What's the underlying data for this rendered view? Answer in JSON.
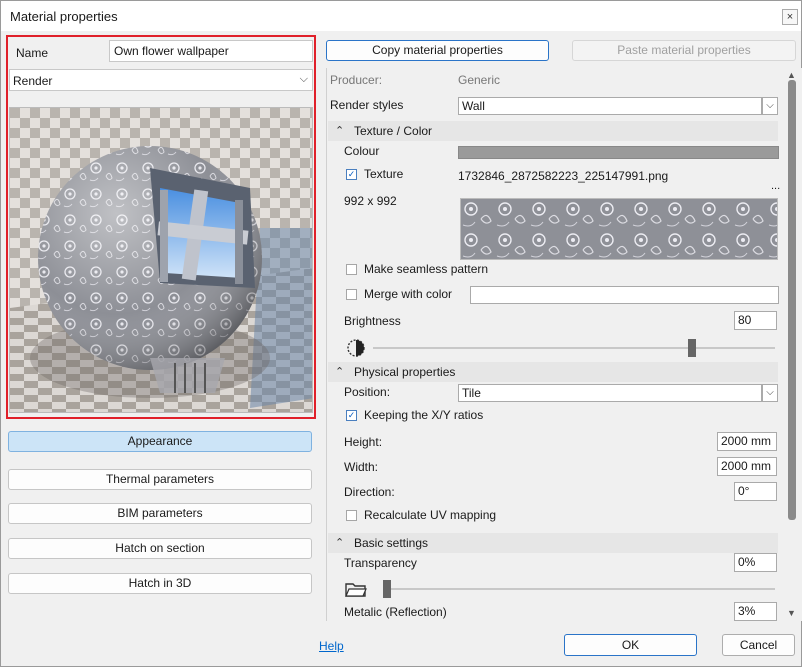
{
  "window": {
    "title": "Material properties",
    "close_glyph": "×"
  },
  "left": {
    "name_label": "Name",
    "name_value": "Own flower wallpaper",
    "render_mode": "Render",
    "buttons": {
      "appearance": "Appearance",
      "thermal": "Thermal parameters",
      "bim": "BIM parameters",
      "hatch_section": "Hatch on section",
      "hatch_3d": "Hatch in 3D"
    }
  },
  "toolbar": {
    "copy_label": "Copy material properties",
    "paste_label": "Paste material properties"
  },
  "props": {
    "producer_label": "Producer:",
    "producer_value": "Generic",
    "render_styles_label": "Render styles",
    "render_styles_value": "Wall",
    "texture_section": "Texture / Color",
    "colour_label": "Colour",
    "colour_value": "#9a9a9a",
    "texture_label": "Texture",
    "texture_checked": true,
    "texture_file": "1732846_2872582223_225147991.png",
    "texture_more": "...",
    "texture_size": "992 x 992",
    "seamless_label": "Make seamless pattern",
    "seamless_checked": false,
    "merge_label": "Merge with color",
    "merge_checked": false,
    "brightness_label": "Brightness",
    "brightness_value": "80",
    "brightness_level": 0.8,
    "physical_section": "Physical properties",
    "position_label": "Position:",
    "position_value": "Tile",
    "keep_ratio_label": "Keeping the X/Y ratios",
    "keep_ratio_checked": true,
    "height_label": "Height:",
    "height_value": "2000 mm",
    "width_label": "Width:",
    "width_value": "2000 mm",
    "direction_label": "Direction:",
    "direction_value": "0°",
    "recalc_label": "Recalculate UV mapping",
    "recalc_checked": false,
    "basic_section": "Basic settings",
    "transparency_label": "Transparency",
    "transparency_value": "0%",
    "transparency_level": 0.0,
    "metalic_label": "Metalic (Reflection)",
    "metalic_value": "3%"
  },
  "footer": {
    "help": "Help",
    "ok": "OK",
    "cancel": "Cancel"
  },
  "icons": {
    "check": "✓",
    "chevron_down": "⌵",
    "chevron_up": "⌃",
    "scroll_up": "▲",
    "scroll_down": "▼"
  },
  "colors": {
    "accent": "#2a74c8",
    "highlight_border": "#e0202a",
    "active_button": "#cce4f7"
  }
}
